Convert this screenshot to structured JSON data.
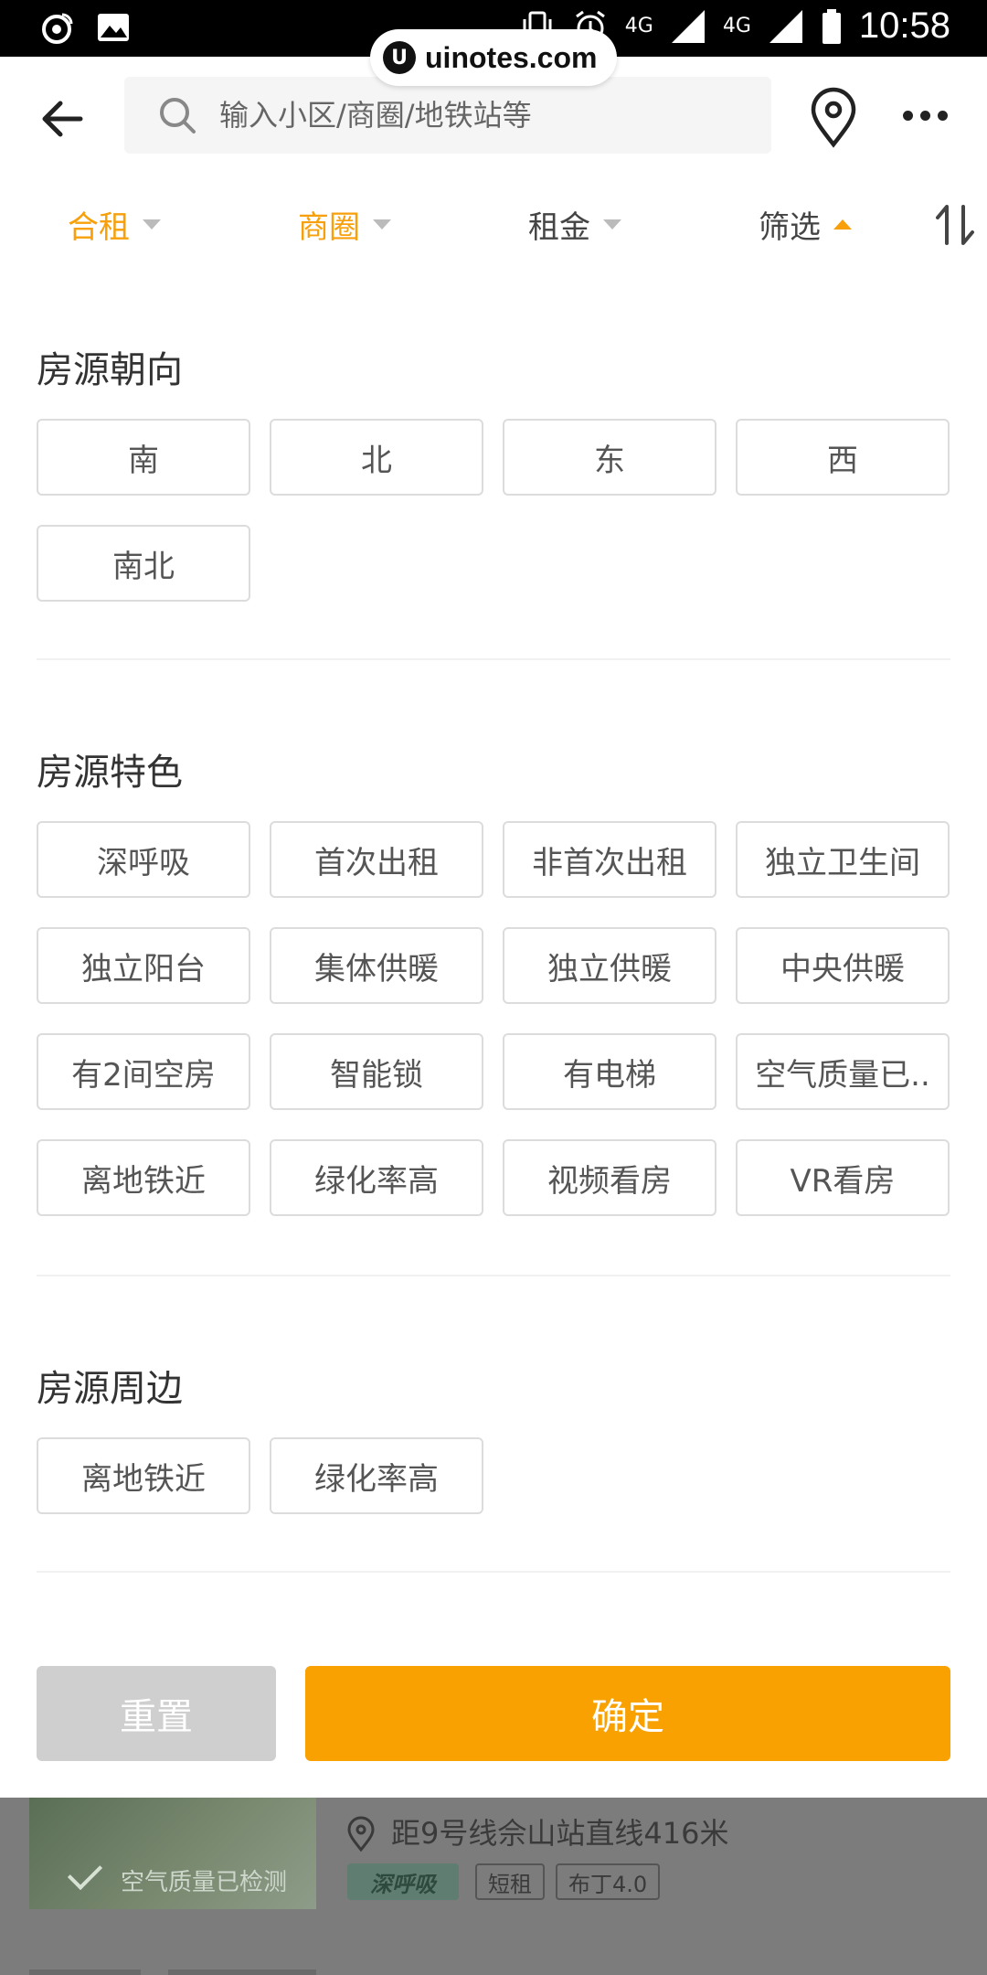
{
  "status_bar": {
    "time": "10:58",
    "network_1": "4G",
    "network_2": "4G",
    "icons": [
      "weibo-icon",
      "gallery-icon",
      "vibrate-icon",
      "alarm-icon",
      "signal-icon",
      "battery-icon"
    ]
  },
  "watermark": {
    "logo": "U",
    "text": "uinotes.com"
  },
  "search": {
    "placeholder": "输入小区/商圈/地铁站等"
  },
  "filters": {
    "tabs": [
      {
        "label": "合租",
        "state": "active"
      },
      {
        "label": "商圈",
        "state": "active"
      },
      {
        "label": "租金",
        "state": "normal"
      },
      {
        "label": "筛选",
        "state": "open"
      }
    ]
  },
  "sections": {
    "orientation": {
      "title": "房源朝向",
      "options": [
        "南",
        "北",
        "东",
        "西",
        "南北"
      ]
    },
    "features": {
      "title": "房源特色",
      "options": [
        "深呼吸",
        "首次出租",
        "非首次出租",
        "独立卫生间",
        "独立阳台",
        "集体供暖",
        "独立供暖",
        "中央供暖",
        "有2间空房",
        "智能锁",
        "有电梯",
        "空气质量已..",
        "离地铁近",
        "绿化率高",
        "视频看房",
        "VR看房"
      ]
    },
    "surroundings": {
      "title": "房源周边",
      "options": [
        "离地铁近",
        "绿化率高"
      ]
    }
  },
  "actions": {
    "reset": "重置",
    "confirm": "确定"
  },
  "listing_preview": {
    "thumb_label": "空气质量已检测",
    "distance": "距9号线佘山站直线416米",
    "tags": [
      "深呼吸",
      "短租",
      "布丁4.0"
    ]
  },
  "colors": {
    "accent": "#f9a100",
    "reset_bg": "#cfcfcf",
    "chip_border": "#dcdcdc"
  }
}
